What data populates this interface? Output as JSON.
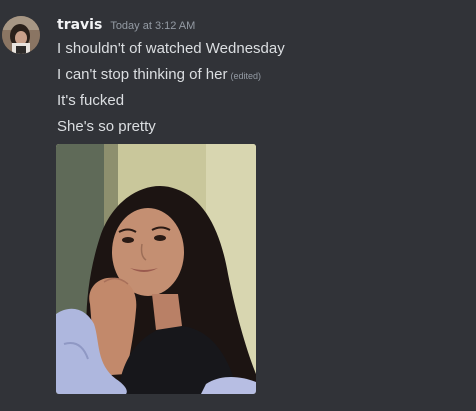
{
  "message": {
    "author": "travis",
    "timestamp": "Today at 3:12 AM",
    "avatar_icon": "user-avatar",
    "lines": [
      {
        "text": "I shouldn't of watched Wednesday",
        "edited": ""
      },
      {
        "text": "I can't stop thinking of her",
        "edited": "(edited)"
      },
      {
        "text": "It's fucked",
        "edited": ""
      },
      {
        "text": "She's so pretty",
        "edited": ""
      }
    ],
    "attachment": {
      "type": "image",
      "icon": "photo-attachment"
    }
  },
  "colors": {
    "background": "#313338",
    "username": "#f2f3f5",
    "message_text": "#dbdee1",
    "muted_text": "#949ba4"
  }
}
